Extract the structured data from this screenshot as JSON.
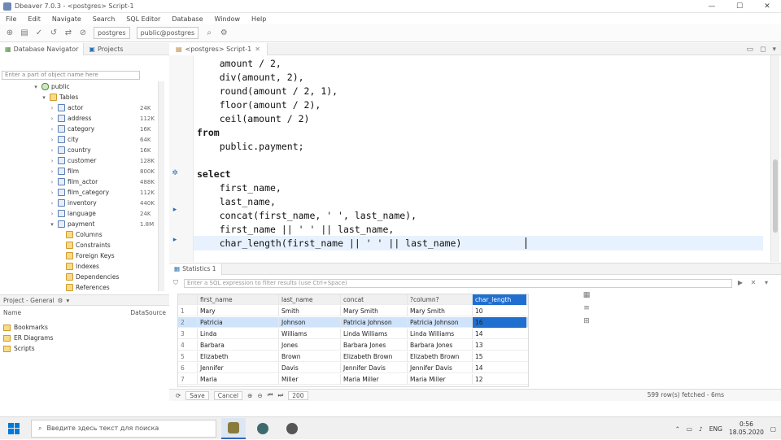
{
  "window": {
    "title": "Dbeaver 7.0.3 - <postgres> Script-1",
    "controls": [
      "—",
      "☐",
      "✕"
    ]
  },
  "menu": [
    "File",
    "Edit",
    "Navigate",
    "Search",
    "SQL Editor",
    "Database",
    "Window",
    "Help"
  ],
  "toolbar": {
    "combo_db": "postgres",
    "combo_schema": "public@postgres"
  },
  "navigator": {
    "tabs": [
      {
        "label": "Database Navigator",
        "icon": "database-navigator-icon"
      },
      {
        "label": "Projects",
        "icon": "projects-icon"
      }
    ],
    "filter_placeholder": "Enter a part of object name here",
    "tree": [
      {
        "label": "public",
        "icon": "db",
        "depth": 1,
        "toggle": "▾",
        "size": ""
      },
      {
        "label": "Tables",
        "icon": "folder",
        "depth": 2,
        "toggle": "▾",
        "size": ""
      },
      {
        "label": "actor",
        "icon": "table",
        "depth": 3,
        "toggle": "›",
        "size": "24K"
      },
      {
        "label": "address",
        "icon": "table",
        "depth": 3,
        "toggle": "›",
        "size": "112K"
      },
      {
        "label": "category",
        "icon": "table",
        "depth": 3,
        "toggle": "›",
        "size": "16K"
      },
      {
        "label": "city",
        "icon": "table",
        "depth": 3,
        "toggle": "›",
        "size": "64K"
      },
      {
        "label": "country",
        "icon": "table",
        "depth": 3,
        "toggle": "›",
        "size": "16K"
      },
      {
        "label": "customer",
        "icon": "table",
        "depth": 3,
        "toggle": "›",
        "size": "128K"
      },
      {
        "label": "film",
        "icon": "table",
        "depth": 3,
        "toggle": "›",
        "size": "800K"
      },
      {
        "label": "film_actor",
        "icon": "table",
        "depth": 3,
        "toggle": "›",
        "size": "488K"
      },
      {
        "label": "film_category",
        "icon": "table",
        "depth": 3,
        "toggle": "›",
        "size": "112K"
      },
      {
        "label": "inventory",
        "icon": "table",
        "depth": 3,
        "toggle": "›",
        "size": "440K"
      },
      {
        "label": "language",
        "icon": "table",
        "depth": 3,
        "toggle": "›",
        "size": "24K"
      },
      {
        "label": "payment",
        "icon": "table",
        "depth": 3,
        "toggle": "▾",
        "size": "1.8M"
      },
      {
        "label": "Columns",
        "icon": "folder",
        "depth": 4,
        "toggle": "",
        "size": ""
      },
      {
        "label": "Constraints",
        "icon": "folder",
        "depth": 4,
        "toggle": "",
        "size": ""
      },
      {
        "label": "Foreign Keys",
        "icon": "folder",
        "depth": 4,
        "toggle": "",
        "size": ""
      },
      {
        "label": "Indexes",
        "icon": "folder",
        "depth": 4,
        "toggle": "",
        "size": ""
      },
      {
        "label": "Dependencies",
        "icon": "folder",
        "depth": 4,
        "toggle": "",
        "size": ""
      },
      {
        "label": "References",
        "icon": "folder",
        "depth": 4,
        "toggle": "",
        "size": ""
      }
    ]
  },
  "projects": {
    "tabs": [
      "Project - General",
      "⚙",
      "▾"
    ],
    "head_name": "Name",
    "head_source": "DataSource",
    "items": [
      "Bookmarks",
      "ER Diagrams",
      "Scripts"
    ]
  },
  "editor": {
    "tab_label": "<postgres> Script-1",
    "controls": [
      "▭",
      "◻",
      "▾"
    ],
    "lines": [
      {
        "text": "    amount / 2,",
        "kw": false
      },
      {
        "text": "    div(amount, 2),",
        "kw": false
      },
      {
        "text": "    round(amount / 2, 1),",
        "kw": false
      },
      {
        "text": "    floor(amount / 2),",
        "kw": false
      },
      {
        "text": "    ceil(amount / 2)",
        "kw": false
      },
      {
        "text": "from",
        "kw": true
      },
      {
        "text": "    public.payment;",
        "kw": false
      },
      {
        "text": "",
        "kw": false
      },
      {
        "text": "select",
        "kw": true
      },
      {
        "text": "    first_name,",
        "kw": false
      },
      {
        "text": "    last_name,",
        "kw": false
      },
      {
        "text": "    concat(first_name, ' ', last_name),",
        "kw": false
      },
      {
        "text": "    first_name || ' ' || last_name,",
        "kw": false
      },
      {
        "text": "    char_length(first_name || ' ' || last_name)",
        "kw": false
      }
    ]
  },
  "results": {
    "tab_label": "Statistics 1",
    "filter_placeholder": "Enter a SQL expression to filter results (use Ctrl+Space)",
    "columns": [
      "first_name",
      "last_name",
      "concat",
      "?column?",
      "char_length"
    ],
    "rows": [
      {
        "n": "1",
        "cells": [
          "Mary",
          "Smith",
          "Mary Smith",
          "Mary Smith",
          "10"
        ]
      },
      {
        "n": "2",
        "cells": [
          "Patricia",
          "Johnson",
          "Patricia Johnson",
          "Patricia Johnson",
          "16"
        ]
      },
      {
        "n": "3",
        "cells": [
          "Linda",
          "Williams",
          "Linda Williams",
          "Linda Williams",
          "14"
        ]
      },
      {
        "n": "4",
        "cells": [
          "Barbara",
          "Jones",
          "Barbara Jones",
          "Barbara Jones",
          "13"
        ]
      },
      {
        "n": "5",
        "cells": [
          "Elizabeth",
          "Brown",
          "Elizabeth Brown",
          "Elizabeth Brown",
          "15"
        ]
      },
      {
        "n": "6",
        "cells": [
          "Jennifer",
          "Davis",
          "Jennifer Davis",
          "Jennifer Davis",
          "14"
        ]
      },
      {
        "n": "7",
        "cells": [
          "Maria",
          "Miller",
          "Maria Miller",
          "Maria Miller",
          "12"
        ]
      }
    ],
    "selected_row": 1,
    "status": {
      "save": "Save",
      "cancel": "Cancel",
      "rows": "200",
      "right": "599 row(s) fetched - 6ms"
    }
  },
  "taskbar": {
    "search_placeholder": "Введите здесь текст для поиска",
    "tray_lang": "ENG",
    "tray_time": "0:56",
    "tray_date": "18.05.2020"
  },
  "colors": {
    "accent": "#1f6fd0",
    "selection": "#cfe3fb",
    "current_line": "#e8f2fe"
  }
}
